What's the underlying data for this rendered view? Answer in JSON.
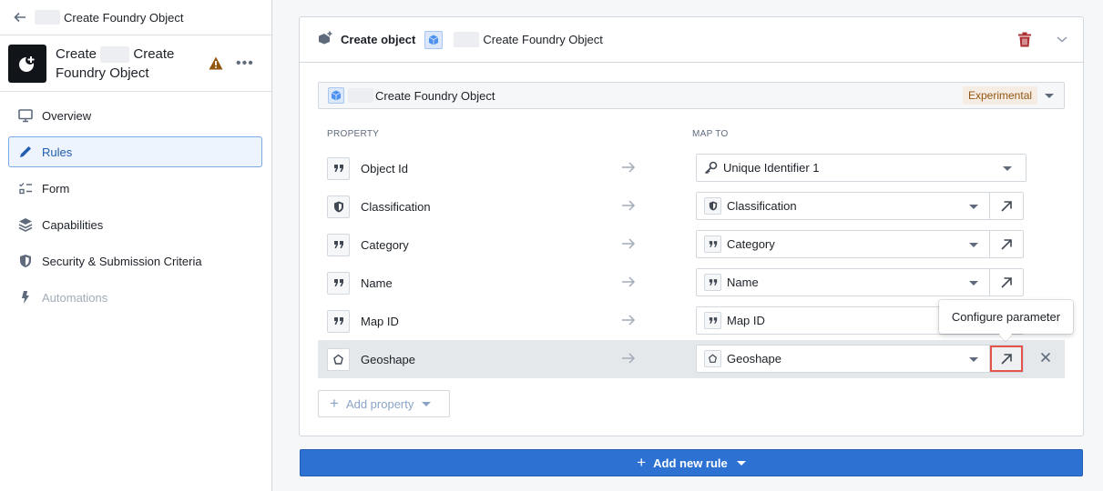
{
  "sidebar": {
    "breadcrumb": "Create Foundry Object",
    "app_title_line1_prefix": "Create",
    "app_title_line1_suffix": "Create",
    "app_title_line2": "Foundry Object",
    "more_label": "•••",
    "nav": [
      {
        "label": "Overview",
        "icon": "monitor-icon",
        "state": "normal"
      },
      {
        "label": "Rules",
        "icon": "edit-icon",
        "state": "active"
      },
      {
        "label": "Form",
        "icon": "form-icon",
        "state": "normal"
      },
      {
        "label": "Capabilities",
        "icon": "layers-icon",
        "state": "normal"
      },
      {
        "label": "Security & Submission Criteria",
        "icon": "shield-icon",
        "state": "normal"
      },
      {
        "label": "Automations",
        "icon": "lightning-icon",
        "state": "disabled"
      }
    ]
  },
  "rule": {
    "type_label": "Create object",
    "object_name": "Create Foundry Object",
    "selector_name": "Create Foundry Object",
    "badge": "Experimental",
    "col_property": "PROPERTY",
    "col_map_to": "MAP TO",
    "rows": [
      {
        "property": "Object Id",
        "prop_icon": "quote-icon",
        "map_to": "Unique Identifier 1",
        "map_icon": "key-icon",
        "has_open": false
      },
      {
        "property": "Classification",
        "prop_icon": "shield-icon",
        "map_to": "Classification",
        "map_icon": "shield-icon",
        "has_open": true
      },
      {
        "property": "Category",
        "prop_icon": "quote-icon",
        "map_to": "Category",
        "map_icon": "quote-icon",
        "has_open": true
      },
      {
        "property": "Name",
        "prop_icon": "quote-icon",
        "map_to": "Name",
        "map_icon": "quote-icon",
        "has_open": true
      },
      {
        "property": "Map ID",
        "prop_icon": "quote-icon",
        "map_to": "Map ID",
        "map_icon": "quote-icon",
        "has_open": true
      },
      {
        "property": "Geoshape",
        "prop_icon": "polygon-icon",
        "map_to": "Geoshape",
        "map_icon": "polygon-icon",
        "has_open": true
      }
    ],
    "tooltip": "Configure parameter",
    "add_property_label": "Add property"
  },
  "footer": {
    "add_rule_label": "Add new rule"
  },
  "colors": {
    "accent": "#2d72d2",
    "danger": "#ac2f33",
    "warning": "#935610",
    "highlight_outline": "#e5534b"
  }
}
